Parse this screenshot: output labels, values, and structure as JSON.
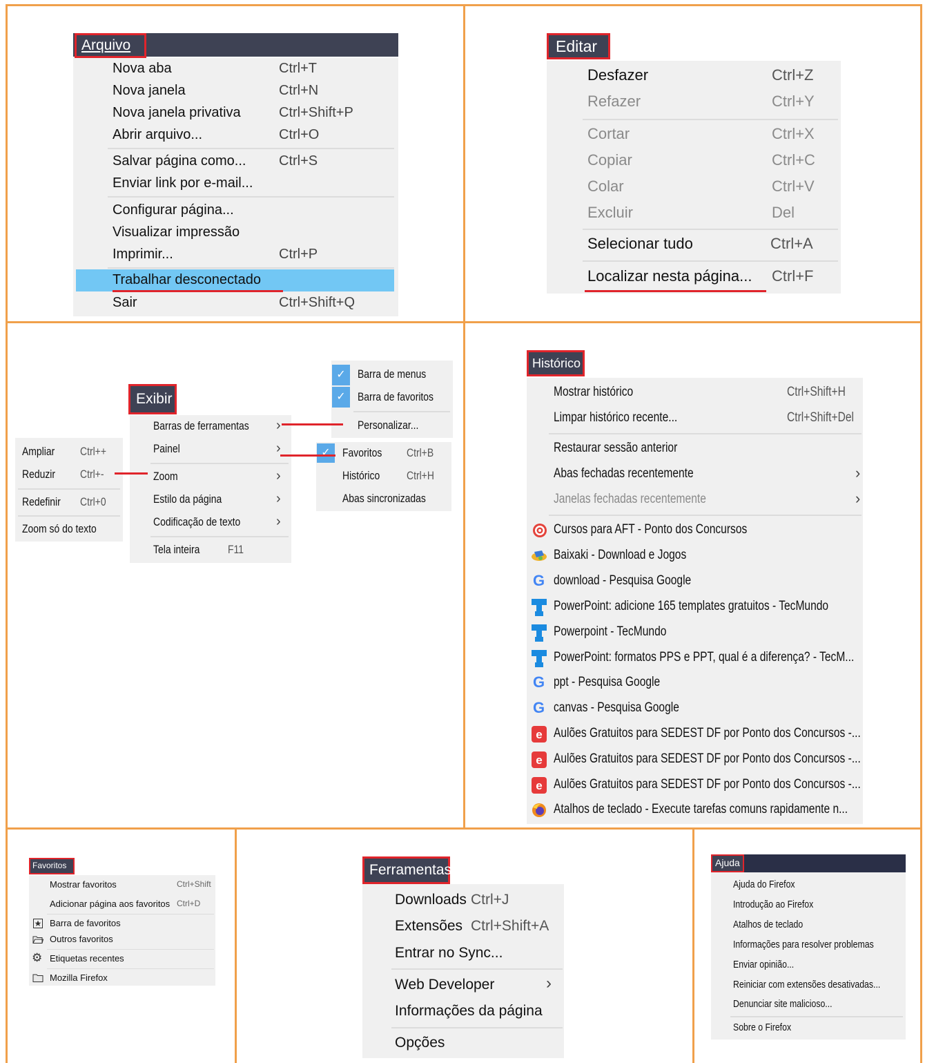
{
  "colors": {
    "grid": "#f0a04b",
    "menu_bg": "#f0f0f0",
    "title_bg": "#3e4254",
    "highlight": "#e0242b",
    "selected": "#72c7f4"
  },
  "arquivo": {
    "title": "Arquivo",
    "items": [
      {
        "label": "Nova aba",
        "shortcut": "Ctrl+T"
      },
      {
        "label": "Nova janela",
        "shortcut": "Ctrl+N"
      },
      {
        "label": "Nova janela privativa",
        "shortcut": "Ctrl+Shift+P"
      },
      {
        "label": "Abrir arquivo...",
        "shortcut": "Ctrl+O"
      },
      {
        "label": "Salvar página como...",
        "shortcut": "Ctrl+S"
      },
      {
        "label": "Enviar link por e-mail...",
        "shortcut": ""
      },
      {
        "label": "Configurar página...",
        "shortcut": ""
      },
      {
        "label": "Visualizar impressão",
        "shortcut": ""
      },
      {
        "label": "Imprimir...",
        "shortcut": "Ctrl+P"
      },
      {
        "label": "Trabalhar desconectado",
        "shortcut": ""
      },
      {
        "label": "Sair",
        "shortcut": "Ctrl+Shift+Q"
      }
    ]
  },
  "editar": {
    "title": "Editar",
    "items": [
      {
        "label": "Desfazer",
        "shortcut": "Ctrl+Z"
      },
      {
        "label": "Refazer",
        "shortcut": "Ctrl+Y"
      },
      {
        "label": "Cortar",
        "shortcut": "Ctrl+X"
      },
      {
        "label": "Copiar",
        "shortcut": "Ctrl+C"
      },
      {
        "label": "Colar",
        "shortcut": "Ctrl+V"
      },
      {
        "label": "Excluir",
        "shortcut": "Del"
      },
      {
        "label": "Selecionar tudo",
        "shortcut": "Ctrl+A"
      },
      {
        "label": "Localizar nesta página...",
        "shortcut": "Ctrl+F"
      }
    ]
  },
  "exibir": {
    "title": "Exibir",
    "items": [
      {
        "label": "Barras de ferramentas",
        "shortcut": ""
      },
      {
        "label": "Painel",
        "shortcut": ""
      },
      {
        "label": "Zoom",
        "shortcut": ""
      },
      {
        "label": "Estilo da página",
        "shortcut": ""
      },
      {
        "label": "Codificação de texto",
        "shortcut": ""
      },
      {
        "label": "Tela inteira",
        "shortcut": "F11"
      }
    ],
    "toolbars_sub": [
      {
        "label": "Barra de menus"
      },
      {
        "label": "Barra de favoritos"
      },
      {
        "label": "Personalizar..."
      }
    ],
    "panel_sub": [
      {
        "label": "Favoritos",
        "shortcut": "Ctrl+B"
      },
      {
        "label": "Histórico",
        "shortcut": "Ctrl+H"
      },
      {
        "label": "Abas sincronizadas",
        "shortcut": ""
      }
    ],
    "zoom_sub": [
      {
        "label": "Ampliar",
        "shortcut": "Ctrl++"
      },
      {
        "label": "Reduzir",
        "shortcut": "Ctrl+-"
      },
      {
        "label": "Redefinir",
        "shortcut": "Ctrl+0"
      },
      {
        "label": "Zoom só do texto",
        "shortcut": ""
      }
    ],
    "chevron": "›",
    "check": "✓"
  },
  "historico": {
    "title": "Histórico",
    "items": [
      {
        "label": "Mostrar histórico",
        "shortcut": "Ctrl+Shift+H"
      },
      {
        "label": "Limpar histórico recente...",
        "shortcut": "Ctrl+Shift+Del"
      },
      {
        "label": "Restaurar sessão anterior",
        "shortcut": ""
      },
      {
        "label": "Abas fechadas recentemente",
        "shortcut": ""
      },
      {
        "label": "Janelas fechadas recentemente",
        "shortcut": ""
      }
    ],
    "entries": [
      {
        "label": "Cursos para AFT - Ponto dos Concursos",
        "icon": "target-icon"
      },
      {
        "label": "Baixaki - Download e Jogos",
        "icon": "baixaki-icon"
      },
      {
        "label": "download - Pesquisa Google",
        "icon": "google-icon"
      },
      {
        "label": "PowerPoint: adicione 165 templates gratuitos - TecMundo",
        "icon": "tecmundo-icon"
      },
      {
        "label": "Powerpoint - TecMundo",
        "icon": "tecmundo-icon"
      },
      {
        "label": "PowerPoint: formatos PPS e PPT, qual é a diferença? - TecM...",
        "icon": "tecmundo-icon"
      },
      {
        "label": "ppt - Pesquisa Google",
        "icon": "google-icon"
      },
      {
        "label": "canvas - Pesquisa Google",
        "icon": "google-icon"
      },
      {
        "label": "Aulões Gratuitos para SEDEST DF por Ponto dos Concursos -...",
        "icon": "estrategia-icon"
      },
      {
        "label": "Aulões Gratuitos para SEDEST DF por Ponto dos Concursos -...",
        "icon": "estrategia-icon"
      },
      {
        "label": "Aulões Gratuitos para SEDEST DF por Ponto dos Concursos -...",
        "icon": "estrategia-icon"
      },
      {
        "label": "Atalhos de teclado - Execute tarefas comuns rapidamente n...",
        "icon": "firefox-icon"
      }
    ]
  },
  "favoritos": {
    "title": "Favoritos",
    "items": [
      {
        "label": "Mostrar favoritos",
        "shortcut": "Ctrl+Shift"
      },
      {
        "label": "Adicionar página aos favoritos",
        "shortcut": "Ctrl+D"
      },
      {
        "label": "Barra de favoritos",
        "icon": "star-toolbar-icon"
      },
      {
        "label": "Outros favoritos",
        "icon": "folder-open-icon"
      },
      {
        "label": "Etiquetas recentes",
        "icon": "gear-icon"
      },
      {
        "label": "Mozilla Firefox",
        "icon": "folder-icon"
      }
    ]
  },
  "ferramentas": {
    "title": "Ferramentas",
    "items": [
      {
        "label": "Downloads",
        "shortcut": "Ctrl+J"
      },
      {
        "label": "Extensões",
        "shortcut": "Ctrl+Shift+A"
      },
      {
        "label": "Entrar no Sync...",
        "shortcut": ""
      },
      {
        "label": "Web Developer",
        "shortcut": ""
      },
      {
        "label": "Informações da página",
        "shortcut": ""
      },
      {
        "label": "Opções",
        "shortcut": ""
      }
    ]
  },
  "ajuda": {
    "title": "Ajuda",
    "items": [
      {
        "label": "Ajuda do Firefox"
      },
      {
        "label": "Introdução ao Firefox"
      },
      {
        "label": "Atalhos de teclado"
      },
      {
        "label": "Informações para resolver problemas"
      },
      {
        "label": "Enviar opinião..."
      },
      {
        "label": "Reiniciar com extensões desativadas..."
      },
      {
        "label": "Denunciar site malicioso..."
      },
      {
        "label": "Sobre o Firefox"
      }
    ]
  }
}
